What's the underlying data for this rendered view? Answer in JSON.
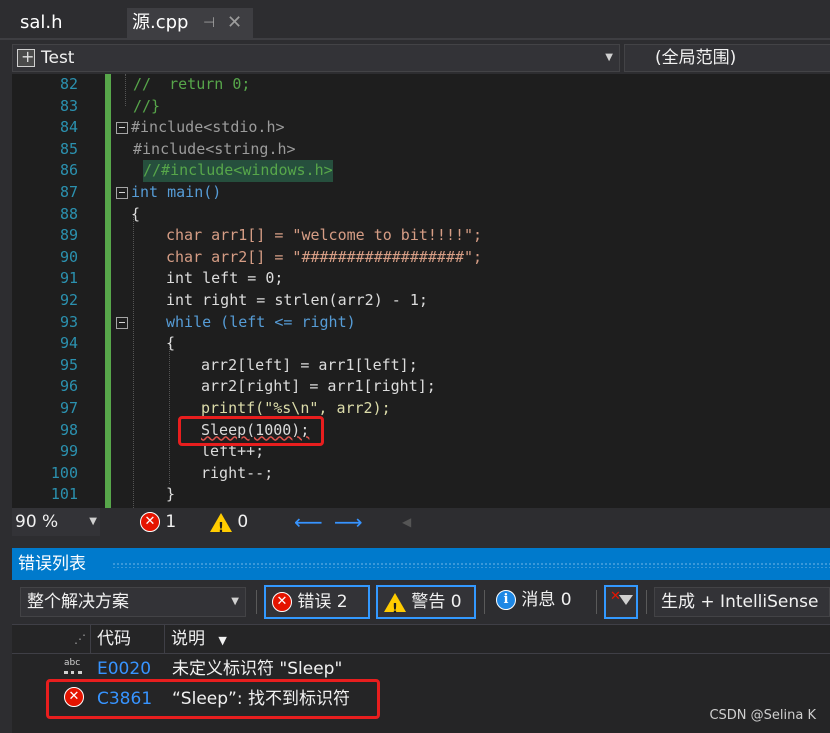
{
  "tabs": [
    {
      "label": "sal.h"
    },
    {
      "label": "源.cpp",
      "pin_icon": "pin-icon",
      "close_icon": "close-icon"
    }
  ],
  "navbar": {
    "project": "Test",
    "scope": "(全局范围)"
  },
  "editor": {
    "line_numbers": [
      "82",
      "83",
      "84",
      "85",
      "86",
      "87",
      "88",
      "89",
      "90",
      "91",
      "92",
      "93",
      "94",
      "95",
      "96",
      "97",
      "98",
      "99",
      "100",
      "101"
    ],
    "lines": [
      "//  return 0;",
      "//}",
      "#include<stdio.h>",
      "#include<string.h>",
      "//#include<windows.h>",
      "int main()",
      "{",
      "char arr1[] = \"welcome to bit!!!!\";",
      "char arr2[] = \"##################\";",
      "int left = 0;",
      "int right = strlen(arr2) - 1;",
      "while (left <= right)",
      "{",
      "arr2[left] = arr1[left];",
      "arr2[right] = arr1[right];",
      "printf(\"%s\\n\", arr2);",
      "Sleep(1000);",
      "left++;",
      "right--;",
      "}"
    ]
  },
  "status": {
    "zoom": "90 %",
    "errors": "1",
    "warnings": "0"
  },
  "error_list": {
    "title": "错误列表",
    "scope": "整个解决方案",
    "errors_btn": "错误 2",
    "warnings_btn": "警告 0",
    "messages_btn": "消息 0",
    "build_filter": "生成 + IntelliSense",
    "col_code": "代码",
    "col_desc": "说明",
    "rows": [
      {
        "icon": "abc-spell-icon",
        "code": "E0020",
        "desc": "未定义标识符 \"Sleep\""
      },
      {
        "icon": "error-icon",
        "code": "C3861",
        "desc": "“Sleep”: 找不到标识符"
      }
    ]
  },
  "watermark": "CSDN @Selina K",
  "colors": {
    "accent": "#007acc",
    "error": "#e51400",
    "callout": "#e81e1e",
    "keyword": "#569cd6",
    "comment": "#57a64a",
    "string": "#d69d85"
  }
}
